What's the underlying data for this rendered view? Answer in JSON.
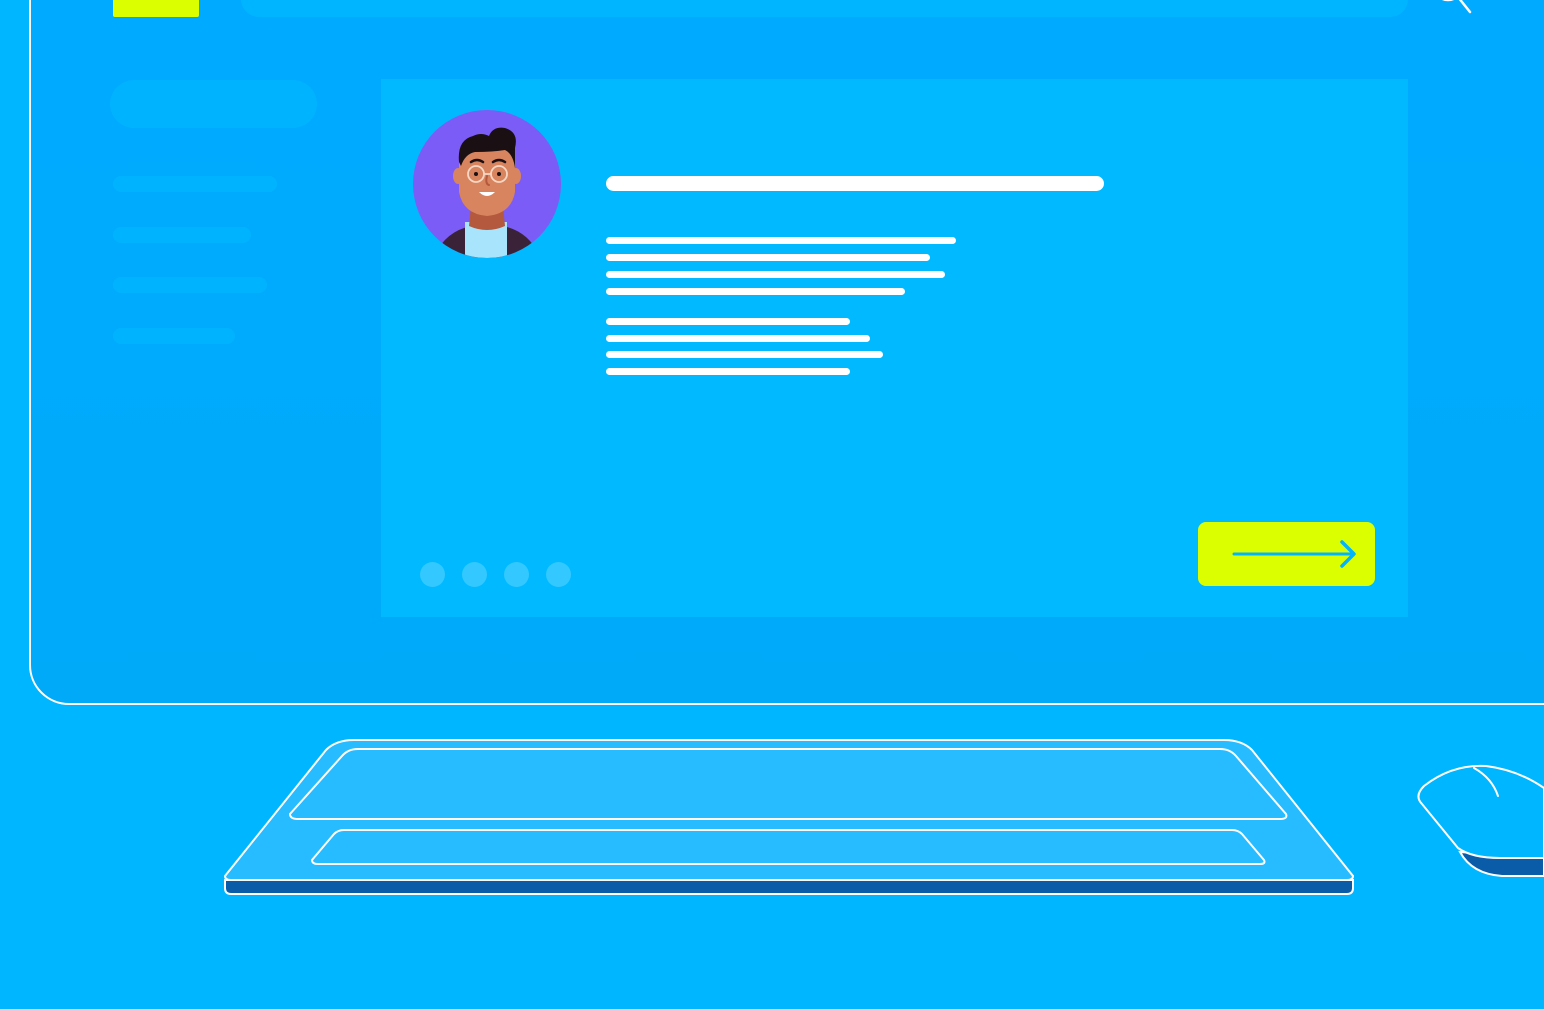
{
  "colors": {
    "background": "#00b7ff",
    "screen": "#00aaff",
    "card": "#00b9ff",
    "accent": "#dcff00",
    "outline": "#ffffff",
    "avatar_bg": "#7c5cf6",
    "keyboard_base": "#0b5ca8"
  },
  "header": {
    "logo": "logo-block",
    "search_icon": "search-icon"
  },
  "sidebar": {
    "items": [
      "placeholder",
      "placeholder",
      "placeholder",
      "placeholder"
    ]
  },
  "card": {
    "avatar_icon": "person-avatar-icon",
    "paragraph_groups": 2,
    "pagination_dots": 4,
    "next_icon": "arrow-right-icon"
  }
}
